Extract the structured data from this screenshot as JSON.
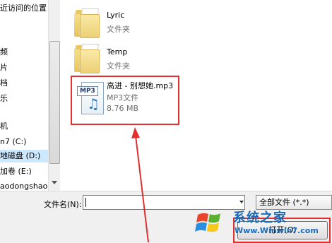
{
  "nav": {
    "items": [
      {
        "label": "近访问的位置",
        "selected": false
      },
      {
        "label": "频",
        "selected": false
      },
      {
        "label": "片",
        "selected": false
      },
      {
        "label": "档",
        "selected": false
      },
      {
        "label": "乐",
        "selected": false
      },
      {
        "label": "机",
        "selected": false
      },
      {
        "label": "n7 (C:)",
        "selected": false
      },
      {
        "label": "地磁盘 (D:)",
        "selected": true
      },
      {
        "label": "加卷 (E:)",
        "selected": false
      },
      {
        "label": "aodongshao",
        "selected": false
      }
    ]
  },
  "files": [
    {
      "name": "Lyric",
      "type": "文件夹",
      "icon": "folder-icon"
    },
    {
      "name": "Temp",
      "type": "文件夹",
      "icon": "folder-icon"
    },
    {
      "name": "高进 - 别想她.mp3",
      "type": "MP3文件",
      "size": "8.76 MB",
      "icon": "mp3-file-icon",
      "badge": "MP3",
      "highlighted": true
    }
  ],
  "bottom": {
    "filename_label": "文件名(N):",
    "filename_value": "",
    "filetype_selected": "全部文件 (*.*)",
    "open_button": "打开(O)"
  },
  "watermark": {
    "title": "系统之家",
    "url": "Www.Winwin7.com"
  },
  "colors": {
    "annotation_red": "#e03030",
    "selection_blue": "#cce8ff",
    "watermark_blue": "#1c6bb8"
  }
}
